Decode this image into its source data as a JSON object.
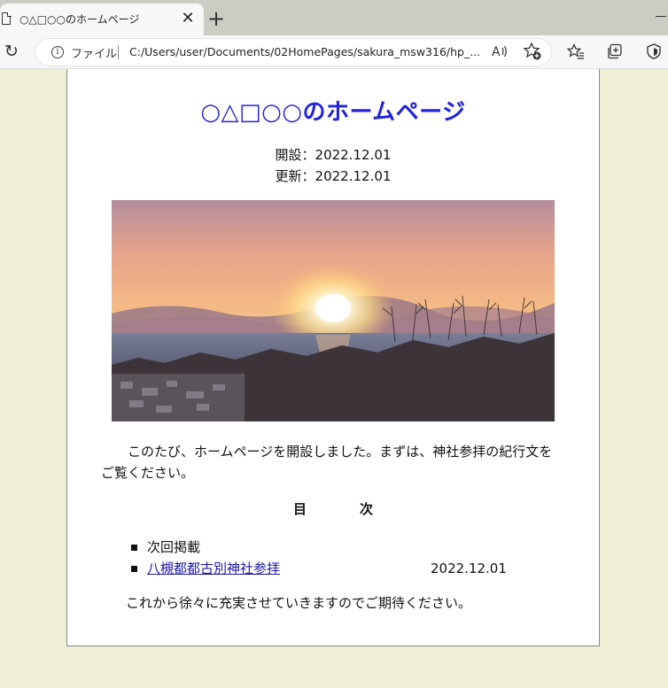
{
  "browser": {
    "tab_title": "○△□○○のホームページ",
    "close_glyph": "✕",
    "newtab_glyph": "+",
    "address": {
      "file_label": "ファイル",
      "url": "C:/Users/user/Documents/02HomePages/sakura_msw316/hp_...",
      "read_aloud_label": "A)"
    }
  },
  "page": {
    "title": "○△□○○のホームページ",
    "opened": "開設：2022.12.01",
    "updated": "更新：2022.12.01",
    "intro": "このたび、ホームページを開設しました。まずは、神社参拝の紀行文をご覧ください。",
    "toc": {
      "heading": "目次",
      "items": [
        {
          "label": "次回掲載",
          "date": ""
        },
        {
          "label": "八槻都都古別神社参拝",
          "date": "2022.12.01"
        }
      ]
    },
    "closing": "これから徐々に充実させていきますのでご期待ください。"
  },
  "colors": {
    "page_background": "#efefd6",
    "title": "#2323dc",
    "link": "#1a1aa6"
  }
}
